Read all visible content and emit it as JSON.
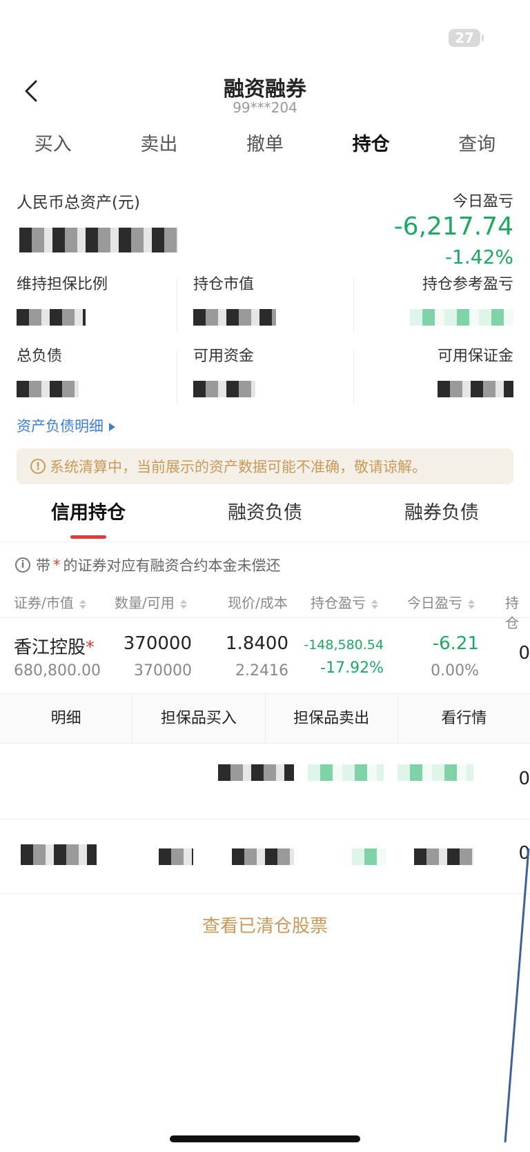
{
  "status": {
    "battery": "27"
  },
  "nav": {
    "title": "融资融券",
    "account": "99***204"
  },
  "top_tabs": [
    "买入",
    "卖出",
    "撤单",
    "持仓",
    "查询"
  ],
  "asset": {
    "total_label": "人民币总资产(元)",
    "today_label": "今日盈亏",
    "today_value": "-6,217.74",
    "today_pct": "-1.42%"
  },
  "metrics": {
    "maintenance_ratio": "维持担保比例",
    "position_value": "持仓市值",
    "ref_pnl": "持仓参考盈亏",
    "total_liability": "总负债",
    "available_funds": "可用资金",
    "available_margin": "可用保证金"
  },
  "detail_link": "资产负债明细",
  "notice": "系统清算中，当前展示的资产数据可能不准确，敬请谅解。",
  "sub_tabs": [
    "信用持仓",
    "融资负债",
    "融券负债"
  ],
  "hint": {
    "prefix": "带",
    "star": "*",
    "suffix": "的证券对应有融资合约本金未偿还"
  },
  "columns": [
    "证券/市值",
    "数量/可用",
    "现价/成本",
    "持仓盈亏",
    "今日盈亏",
    "持仓"
  ],
  "rows": [
    {
      "name": "香江控股",
      "star": "*",
      "market_value": "680,800.00",
      "qty": "370000",
      "available": "370000",
      "price": "1.8400",
      "cost": "2.2416",
      "pnl": "-148,580.54",
      "pnl_pct": "-17.92%",
      "today_pnl": "-6.21",
      "today_pct": "0.00%",
      "trail": "0"
    }
  ],
  "row_trails": [
    "0",
    "0"
  ],
  "actions": [
    "明细",
    "担保品买入",
    "担保品卖出",
    "看行情"
  ],
  "cleared_link": "查看已清仓股票",
  "colors": {
    "green": "#1da861",
    "red": "#e03a3a",
    "gold": "#c89a5a",
    "blue": "#3b7ed6"
  }
}
